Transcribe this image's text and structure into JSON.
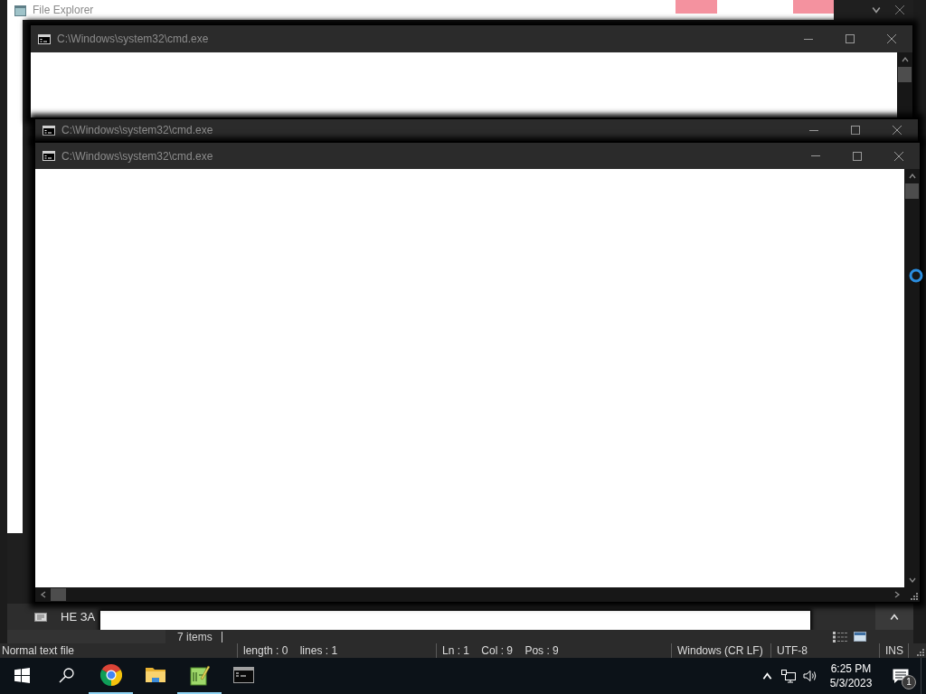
{
  "file_explorer": {
    "title": "File Explorer",
    "banner_text": "НЕ ЗА",
    "item_count": "7 items"
  },
  "cmd_windows": [
    {
      "title": "C:\\Windows\\system32\\cmd.exe"
    },
    {
      "title": "C:\\Windows\\system32\\cmd.exe"
    },
    {
      "title": "C:\\Windows\\system32\\cmd.exe"
    }
  ],
  "notepad_status_bar": {
    "fields": [
      "Normal text file",
      "length : 0    lines : 1",
      "Ln : 1    Col : 9    Pos : 9",
      "Windows (CR LF)",
      "UTF-8",
      "INS"
    ]
  },
  "taskbar": {
    "buttons": [
      {
        "kind": "start",
        "open": false
      },
      {
        "kind": "search",
        "open": false
      },
      {
        "kind": "browser",
        "open": true
      },
      {
        "kind": "folder",
        "open": false
      },
      {
        "kind": "notepad",
        "open": true
      },
      {
        "kind": "terminal",
        "open": false
      }
    ],
    "clock": {
      "time": "6:25 PM",
      "date": "5/3/2023"
    },
    "notifications": {
      "count": "1"
    }
  }
}
